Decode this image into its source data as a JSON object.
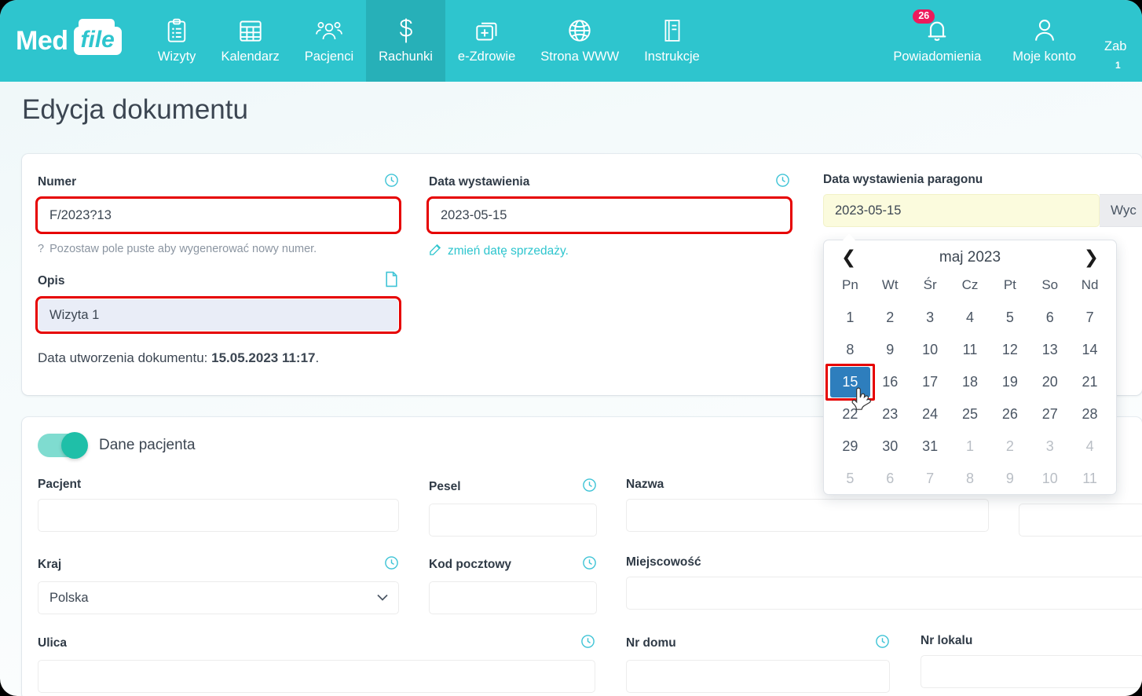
{
  "brand": {
    "med": "Med",
    "file": "file"
  },
  "nav": {
    "items": [
      {
        "label": "Wizyty",
        "icon": "clipboard-icon",
        "active": false
      },
      {
        "label": "Kalendarz",
        "icon": "calendar-icon",
        "active": false
      },
      {
        "label": "Pacjenci",
        "icon": "users-icon",
        "active": false
      },
      {
        "label": "Rachunki",
        "icon": "dollar-icon",
        "active": true
      },
      {
        "label": "e-Zdrowie",
        "icon": "health-card-icon",
        "active": false
      },
      {
        "label": "Strona WWW",
        "icon": "globe-icon",
        "active": false
      },
      {
        "label": "Instrukcje",
        "icon": "book-icon",
        "active": false
      }
    ],
    "right": [
      {
        "label": "Powiadomienia",
        "icon": "bell-icon",
        "badge": "26"
      },
      {
        "label": "Moje konto",
        "icon": "user-icon",
        "badge": ""
      }
    ],
    "clipped": {
      "label": "Zab",
      "sub": "1"
    }
  },
  "page": {
    "title": "Edycja dokumentu"
  },
  "document": {
    "numer": {
      "label": "Numer",
      "value": "F/2023?13",
      "hint": "Pozostaw pole puste aby wygenerować nowy numer.",
      "hint_icon": "question-mark-icon",
      "icon": "clock-icon"
    },
    "opis": {
      "label": "Opis",
      "value": "Wizyta 1",
      "icon": "document-icon"
    },
    "created": {
      "prefix": "Data utworzenia dokumentu:",
      "value": "15.05.2023 11:17",
      "suffix": "."
    },
    "data_wystawienia": {
      "label": "Data wystawienia",
      "value": "2023-05-15",
      "icon": "clock-icon",
      "link": "zmień datę sprzedaży.",
      "link_icon": "edit-icon"
    },
    "data_paragonu": {
      "label": "Data wystawienia paragonu",
      "value": "2023-05-15",
      "button": "Wyc"
    }
  },
  "datepicker": {
    "prev": "❮",
    "next": "❯",
    "month_label": "maj 2023",
    "dow": [
      "Pn",
      "Wt",
      "Śr",
      "Cz",
      "Pt",
      "So",
      "Nd"
    ],
    "weeks": [
      [
        {
          "d": "1"
        },
        {
          "d": "2"
        },
        {
          "d": "3"
        },
        {
          "d": "4"
        },
        {
          "d": "5"
        },
        {
          "d": "6"
        },
        {
          "d": "7"
        }
      ],
      [
        {
          "d": "8"
        },
        {
          "d": "9"
        },
        {
          "d": "10"
        },
        {
          "d": "11"
        },
        {
          "d": "12"
        },
        {
          "d": "13"
        },
        {
          "d": "14"
        }
      ],
      [
        {
          "d": "15",
          "sel": true
        },
        {
          "d": "16"
        },
        {
          "d": "17"
        },
        {
          "d": "18"
        },
        {
          "d": "19"
        },
        {
          "d": "20"
        },
        {
          "d": "21"
        }
      ],
      [
        {
          "d": "22"
        },
        {
          "d": "23"
        },
        {
          "d": "24"
        },
        {
          "d": "25"
        },
        {
          "d": "26"
        },
        {
          "d": "27"
        },
        {
          "d": "28"
        }
      ],
      [
        {
          "d": "29"
        },
        {
          "d": "30"
        },
        {
          "d": "31"
        },
        {
          "d": "1",
          "muted": true
        },
        {
          "d": "2",
          "muted": true
        },
        {
          "d": "3",
          "muted": true
        },
        {
          "d": "4",
          "muted": true
        }
      ],
      [
        {
          "d": "5",
          "muted": true
        },
        {
          "d": "6",
          "muted": true
        },
        {
          "d": "7",
          "muted": true
        },
        {
          "d": "8",
          "muted": true
        },
        {
          "d": "9",
          "muted": true
        },
        {
          "d": "10",
          "muted": true
        },
        {
          "d": "11",
          "muted": true
        }
      ]
    ],
    "selected_day": "15"
  },
  "patient": {
    "toggle_label": "Dane pacjenta",
    "toggle_on": true,
    "fields": [
      {
        "label": "Pacjent",
        "value": "",
        "icon": ""
      },
      {
        "label": "Pesel",
        "value": "",
        "icon": "clock-icon"
      },
      {
        "label": "Nazwa",
        "value": "",
        "icon": ""
      },
      {
        "label": "Kraj",
        "value": "Polska",
        "icon": "clock-icon",
        "type": "select"
      },
      {
        "label": "Kod pocztowy",
        "value": "",
        "icon": "clock-icon"
      },
      {
        "label": "Miejscowość",
        "value": "",
        "icon": ""
      },
      {
        "label": "Ulica",
        "value": "",
        "icon": "clock-icon"
      },
      {
        "label": "Nr domu",
        "value": "",
        "icon": "clock-icon"
      },
      {
        "label": "Nr lokalu",
        "value": "",
        "icon": ""
      }
    ]
  },
  "colors": {
    "brand_teal": "#2ec5ce",
    "brand_teal_active": "#27b0b8",
    "badge_pink": "#ec1a5c",
    "toggle_green": "#1fbfa8",
    "annotation_red": "#e60000",
    "selected_day_blue": "#2e7ebd",
    "yellow_field": "#fbfbdd"
  }
}
